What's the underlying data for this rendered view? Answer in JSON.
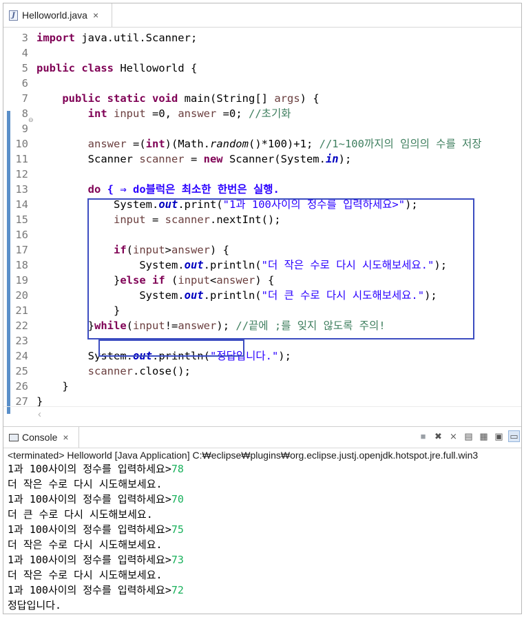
{
  "editor": {
    "tab_label": "Helloworld.java",
    "close_glyph": "×"
  },
  "code": {
    "lines": [
      {
        "n": "3"
      },
      {
        "n": "4"
      },
      {
        "n": "5"
      },
      {
        "n": "6"
      },
      {
        "n": "7"
      },
      {
        "n": "8"
      },
      {
        "n": "9"
      },
      {
        "n": "10"
      },
      {
        "n": "11"
      },
      {
        "n": "12"
      },
      {
        "n": "13"
      },
      {
        "n": "14"
      },
      {
        "n": "15"
      },
      {
        "n": "16"
      },
      {
        "n": "17"
      },
      {
        "n": "18"
      },
      {
        "n": "19"
      },
      {
        "n": "20"
      },
      {
        "n": "21"
      },
      {
        "n": "22"
      },
      {
        "n": "23"
      },
      {
        "n": "24"
      },
      {
        "n": "25"
      },
      {
        "n": "26"
      },
      {
        "n": "27"
      }
    ],
    "t": {
      "import": "import",
      "import_rest": " java.util.Scanner;",
      "public": "public",
      "class": "class",
      "class_name": " Helloworld {",
      "static": "static",
      "void": "void",
      "main_sig_a": " main(String[] ",
      "args": "args",
      "main_sig_b": ") {",
      "int": "int",
      "input": "input",
      "eq0": " =0, ",
      "answer": "answer",
      "eq0b": " =0; ",
      "cmt8": "//초기화",
      "eq": " =(",
      "cast_close": ")(Math.",
      "random": "random",
      "rand_rest": "()*100)+1; ",
      "cmt10": "//1~100까지의 임의의 수를 저장",
      "scanner_cls": "Scanner ",
      "scanner": "scanner",
      "assign_new": " = ",
      "new": "new",
      "new_rest": " Scanner(System.",
      "in": "in",
      "close_paren_semi": ");",
      "do": "do",
      "do_comment": " { ⇒ do블럭은 최소한 한번은 실행.",
      "system_dot": "System.",
      "out": "out",
      "print": ".print(",
      "str14": "\"1과 100사이의 정수를 입력하세요>\"",
      "assign": " = ",
      "next_int": ".nextInt();",
      "if": "if",
      "cond_open": "(",
      "gt": ">",
      "cond_close": ") {",
      "println": ".println(",
      "str18": "\"더 작은 수로 다시 시도해보세요.\"",
      "brace_close": "}",
      "else": "else",
      "lt": "<",
      "str20": "\"더 큰 수로 다시 시도해보세요.\"",
      "while": "while",
      "neq": "!=",
      "cmt22": " //끝에 ;를 잊지 않도록 주의!",
      "str24": "\"정답입니다.\"",
      "close_call": ".close();",
      "rbrace": "}"
    }
  },
  "console": {
    "tab_label": "Console",
    "close_glyph": "×",
    "status": "<terminated> Helloworld [Java Application] C:₩eclipse₩plugins₩org.eclipse.justj.openjdk.hotspot.jre.full.win3",
    "lines": [
      {
        "text": "1과 100사이의 정수를 입력하세요>",
        "input": "78"
      },
      {
        "text": "더 작은 수로 다시 시도해보세요.",
        "input": ""
      },
      {
        "text": "1과 100사이의 정수를 입력하세요>",
        "input": "70"
      },
      {
        "text": "더 큰 수로 다시 시도해보세요.",
        "input": ""
      },
      {
        "text": "1과 100사이의 정수를 입력하세요>",
        "input": "75"
      },
      {
        "text": "더 작은 수로 다시 시도해보세요.",
        "input": ""
      },
      {
        "text": "1과 100사이의 정수를 입력하세요>",
        "input": "73"
      },
      {
        "text": "더 작은 수로 다시 시도해보세요.",
        "input": ""
      },
      {
        "text": "1과 100사이의 정수를 입력하세요>",
        "input": "72"
      },
      {
        "text": "정답입니다.",
        "input": ""
      }
    ],
    "toolbar": [
      "terminate-icon",
      "remove-launch-icon",
      "remove-all-icon",
      "scroll-lock-icon",
      "word-wrap-icon",
      "show-when-output-icon",
      "pin-console-icon"
    ]
  },
  "colors": {
    "keyword": "#7f0055",
    "comment": "#3f7f5f",
    "string": "#2a00ff",
    "annotation_box": "#3b4cc0",
    "user_input": "#1ab15c"
  }
}
